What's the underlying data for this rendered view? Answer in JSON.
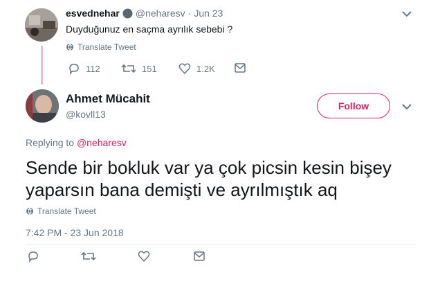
{
  "parent_tweet": {
    "display_name": "esvednehar",
    "handle": "@neharesv",
    "separator": "·",
    "date": "Jun 23",
    "text": "Duyduğunuz en saçma ayrılık sebebi ?",
    "translate_label": "Translate Tweet",
    "actions": {
      "replies": "112",
      "retweets": "151",
      "likes": "1.2K"
    },
    "icons": [
      "reply-icon",
      "retweet-icon",
      "like-icon",
      "dm-icon",
      "globe-icon",
      "chevron-down-icon",
      "verified-badge-icon"
    ]
  },
  "reply_tweet": {
    "display_name": "Ahmet Mücahit",
    "handle": "@kovll13",
    "follow_label": "Follow",
    "replying_prefix": "Replying to",
    "replying_to": "@neharesv",
    "text_line1": "Sende bir bokluk var ya çok picsin kesin bişey",
    "text_line2": "yaparsın bana demişti ve ayrılmıştık aq",
    "translate_label": "Translate Tweet",
    "timestamp": "7:42 PM - 23 Jun 2018",
    "icons": [
      "reply-icon",
      "retweet-icon",
      "like-icon",
      "dm-icon",
      "globe-icon",
      "chevron-down-icon"
    ]
  },
  "colors": {
    "accent": "#e0245e",
    "thread_line": "#f7b7cf",
    "muted": "#657786",
    "text": "#14171a"
  }
}
